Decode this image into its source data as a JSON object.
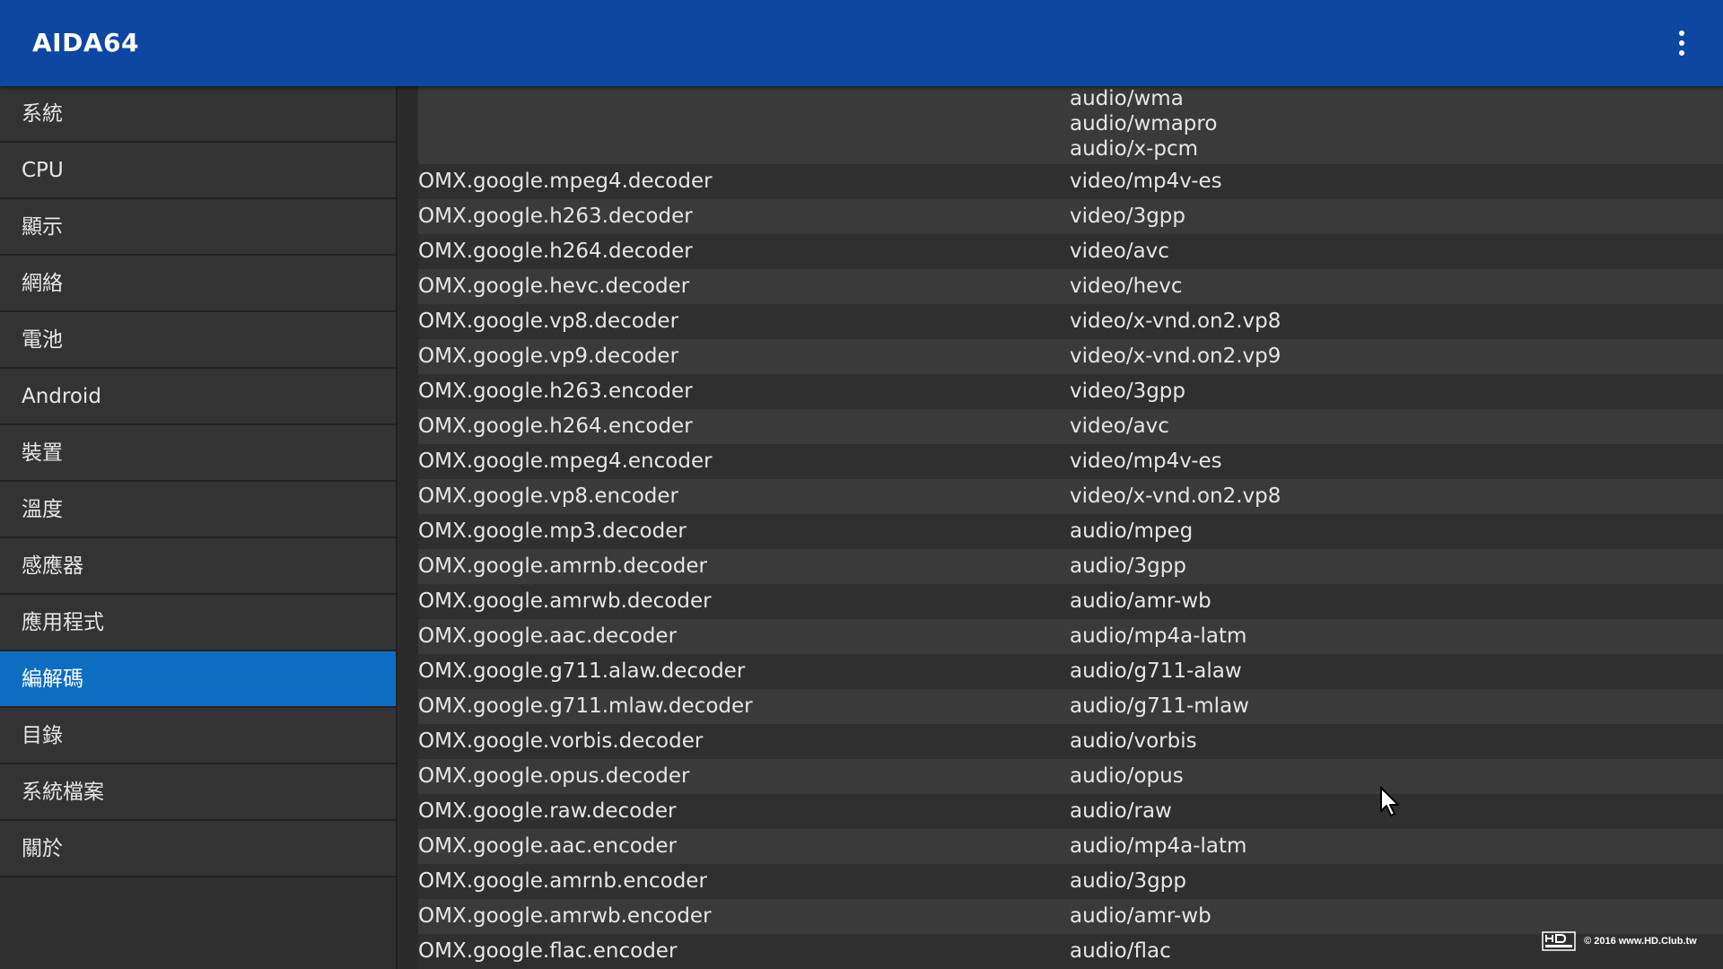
{
  "appbar": {
    "title": "AIDA64",
    "overflow_icon": "more-vert-icon"
  },
  "sidebar": {
    "items": [
      {
        "label": "系統"
      },
      {
        "label": "CPU"
      },
      {
        "label": "顯示"
      },
      {
        "label": "網絡"
      },
      {
        "label": "電池"
      },
      {
        "label": "Android"
      },
      {
        "label": "裝置"
      },
      {
        "label": "溫度"
      },
      {
        "label": "感應器"
      },
      {
        "label": "應用程式"
      },
      {
        "label": "編解碼",
        "active": true
      },
      {
        "label": "目錄"
      },
      {
        "label": "系統檔案"
      },
      {
        "label": "關於"
      }
    ]
  },
  "codecs": {
    "partial_row_mimes": [
      "audio/wma",
      "audio/wmapro",
      "audio/x-pcm"
    ],
    "rows": [
      {
        "name": "OMX.google.mpeg4.decoder",
        "mime": "video/mp4v-es"
      },
      {
        "name": "OMX.google.h263.decoder",
        "mime": "video/3gpp"
      },
      {
        "name": "OMX.google.h264.decoder",
        "mime": "video/avc"
      },
      {
        "name": "OMX.google.hevc.decoder",
        "mime": "video/hevc"
      },
      {
        "name": "OMX.google.vp8.decoder",
        "mime": "video/x-vnd.on2.vp8"
      },
      {
        "name": "OMX.google.vp9.decoder",
        "mime": "video/x-vnd.on2.vp9"
      },
      {
        "name": "OMX.google.h263.encoder",
        "mime": "video/3gpp"
      },
      {
        "name": "OMX.google.h264.encoder",
        "mime": "video/avc"
      },
      {
        "name": "OMX.google.mpeg4.encoder",
        "mime": "video/mp4v-es"
      },
      {
        "name": "OMX.google.vp8.encoder",
        "mime": "video/x-vnd.on2.vp8"
      },
      {
        "name": "OMX.google.mp3.decoder",
        "mime": "audio/mpeg"
      },
      {
        "name": "OMX.google.amrnb.decoder",
        "mime": "audio/3gpp"
      },
      {
        "name": "OMX.google.amrwb.decoder",
        "mime": "audio/amr-wb"
      },
      {
        "name": "OMX.google.aac.decoder",
        "mime": "audio/mp4a-latm"
      },
      {
        "name": "OMX.google.g711.alaw.decoder",
        "mime": "audio/g711-alaw"
      },
      {
        "name": "OMX.google.g711.mlaw.decoder",
        "mime": "audio/g711-mlaw"
      },
      {
        "name": "OMX.google.vorbis.decoder",
        "mime": "audio/vorbis"
      },
      {
        "name": "OMX.google.opus.decoder",
        "mime": "audio/opus"
      },
      {
        "name": "OMX.google.raw.decoder",
        "mime": "audio/raw"
      },
      {
        "name": "OMX.google.aac.encoder",
        "mime": "audio/mp4a-latm"
      },
      {
        "name": "OMX.google.amrnb.encoder",
        "mime": "audio/3gpp"
      },
      {
        "name": "OMX.google.amrwb.encoder",
        "mime": "audio/amr-wb"
      },
      {
        "name": "OMX.google.flac.encoder",
        "mime": "audio/flac"
      }
    ]
  },
  "watermark": {
    "text": "© 2016  www.HD.Club.tw"
  },
  "colors": {
    "appbar": "#0d47a1",
    "active_item": "#0e6cc1"
  }
}
